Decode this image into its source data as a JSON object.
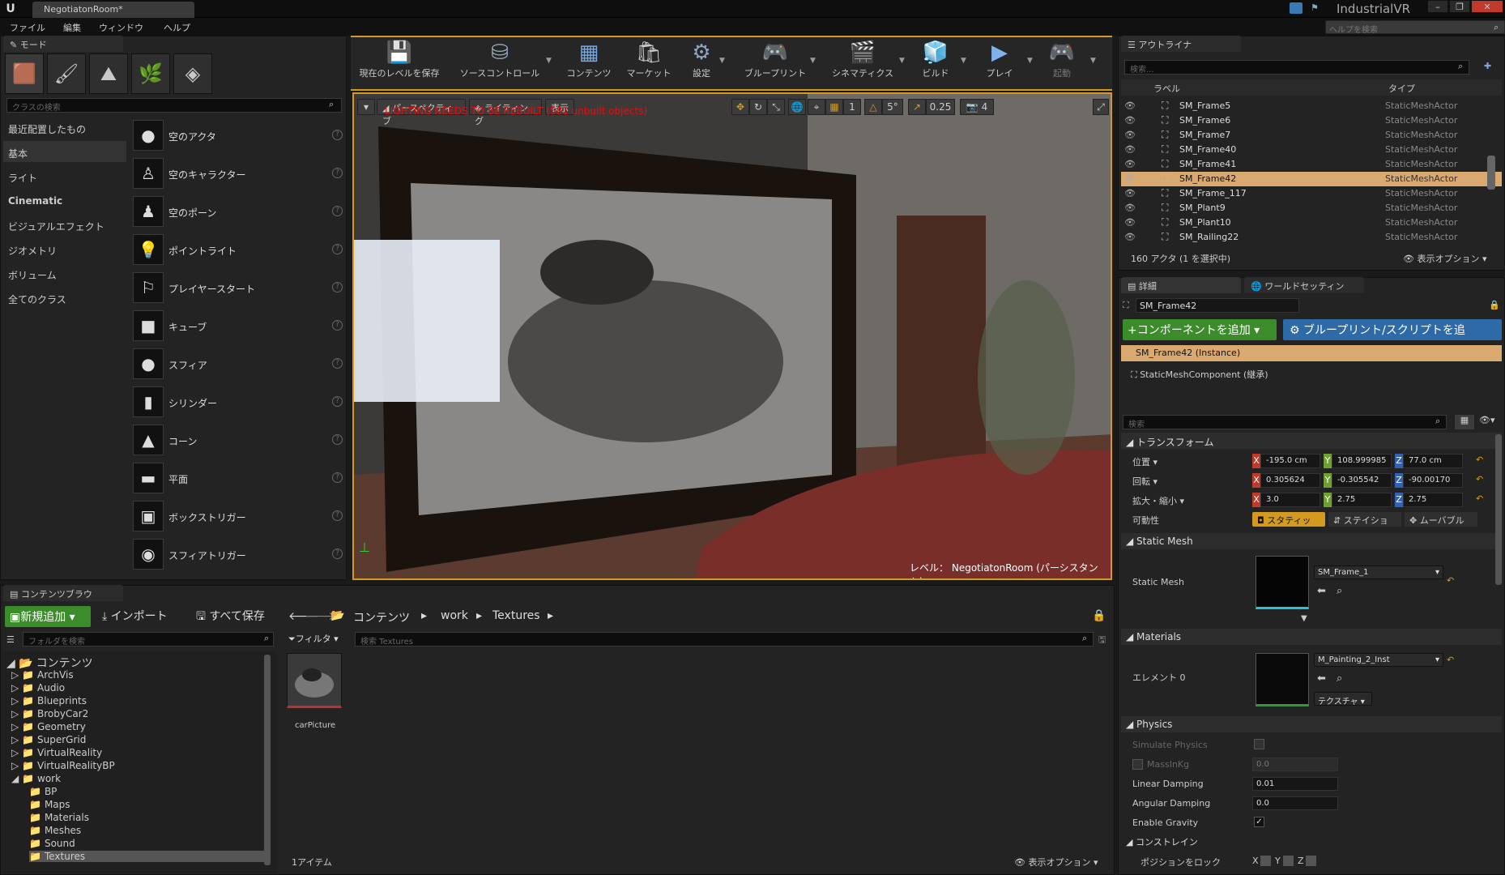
{
  "titlebar": {
    "tab": "NegotiatonRoom*",
    "project": "IndustrialVR"
  },
  "menu": [
    "ファイル",
    "編集",
    "ウィンドウ",
    "ヘルプ"
  ],
  "help_search": {
    "placeholder": "ヘルプを検索"
  },
  "modes": {
    "tab": "モード",
    "search_placeholder": "クラスの検索",
    "categories": [
      "最近配置したもの",
      "基本",
      "ライト",
      "Cinematic",
      "ビジュアルエフェクト",
      "ジオメトリ",
      "ボリューム",
      "全てのクラス"
    ],
    "selected_category": "基本",
    "items": [
      {
        "label": "空のアクタ",
        "icon": "sphere-icon"
      },
      {
        "label": "空のキャラクター",
        "icon": "character-icon"
      },
      {
        "label": "空のポーン",
        "icon": "pawn-icon"
      },
      {
        "label": "ポイントライト",
        "icon": "lightbulb-icon"
      },
      {
        "label": "プレイヤースタート",
        "icon": "flag-icon"
      },
      {
        "label": "キューブ",
        "icon": "cube-icon"
      },
      {
        "label": "スフィア",
        "icon": "sphere-icon"
      },
      {
        "label": "シリンダー",
        "icon": "cylinder-icon"
      },
      {
        "label": "コーン",
        "icon": "cone-icon"
      },
      {
        "label": "平面",
        "icon": "plane-icon"
      },
      {
        "label": "ボックストリガー",
        "icon": "box-trigger-icon"
      },
      {
        "label": "スフィアトリガー",
        "icon": "sphere-trigger-icon"
      }
    ]
  },
  "toolbar": [
    {
      "label": "現在のレベルを保存",
      "icon": "save-icon"
    },
    {
      "label": "ソースコントロール",
      "icon": "source-control-icon"
    },
    {
      "label": "コンテンツ",
      "icon": "content-icon"
    },
    {
      "label": "マーケット",
      "icon": "marketplace-icon"
    },
    {
      "label": "設定",
      "icon": "settings-icon"
    },
    {
      "label": "ブループリント",
      "icon": "blueprint-icon"
    },
    {
      "label": "シネマティクス",
      "icon": "cinematics-icon"
    },
    {
      "label": "ビルド",
      "icon": "build-icon"
    },
    {
      "label": "プレイ",
      "icon": "play-icon"
    },
    {
      "label": "起動",
      "icon": "launch-icon"
    }
  ],
  "viewport": {
    "perspective": "パースペクティブ",
    "lighting": "ライティング",
    "show": "表示",
    "warning": "LIGHTING NEEDS TO BE REBUILT (581 unbuilt objects)",
    "snap_angle": "5°",
    "scale_snap": "0.25",
    "cam_speed": "4",
    "grid_value": "1",
    "level_label": "レベル：",
    "level_name": "NegotiatonRoom (パーシスタント)"
  },
  "outliner": {
    "tab": "アウトライナ",
    "search_placeholder": "検索...",
    "col_label": "ラベル",
    "col_type": "タイプ",
    "rows": [
      {
        "label": "SM_Frame5",
        "type": "StaticMeshActor",
        "selected": false
      },
      {
        "label": "SM_Frame6",
        "type": "StaticMeshActor",
        "selected": false
      },
      {
        "label": "SM_Frame7",
        "type": "StaticMeshActor",
        "selected": false
      },
      {
        "label": "SM_Frame40",
        "type": "StaticMeshActor",
        "selected": false
      },
      {
        "label": "SM_Frame41",
        "type": "StaticMeshActor",
        "selected": false
      },
      {
        "label": "SM_Frame42",
        "type": "StaticMeshActor",
        "selected": true
      },
      {
        "label": "SM_Frame_117",
        "type": "StaticMeshActor",
        "selected": false
      },
      {
        "label": "SM_Plant9",
        "type": "StaticMeshActor",
        "selected": false
      },
      {
        "label": "SM_Plant10",
        "type": "StaticMeshActor",
        "selected": false
      },
      {
        "label": "SM_Railing22",
        "type": "StaticMeshActor",
        "selected": false
      }
    ],
    "status": "160 アクタ (1 を選択中)",
    "view_options": "表示オプション"
  },
  "details": {
    "tab": "詳細",
    "tab2": "ワールドセッティン",
    "name": "SM_Frame42",
    "add_component": "コンポーネントを追加",
    "blueprint_script": "ブループリント/スクリプトを追",
    "instance": "SM_Frame42 (Instance)",
    "component": "StaticMeshComponent (継承)",
    "search_placeholder": "検索",
    "transform": {
      "header": "トランスフォーム",
      "location_label": "位置",
      "rotation_label": "回転",
      "scale_label": "拡大・縮小",
      "mobility_label": "可動性",
      "location": [
        "-195.0 cm",
        "108.999985",
        "77.0 cm"
      ],
      "rotation": [
        "0.305624",
        "-0.305542",
        "-90.00170"
      ],
      "scale": [
        "3.0",
        "2.75",
        "2.75"
      ],
      "mobility": [
        "スタティッ",
        "ステイショ",
        "ムーバブル"
      ]
    },
    "static_mesh": {
      "header": "Static Mesh",
      "label": "Static Mesh",
      "value": "SM_Frame_1"
    },
    "materials": {
      "header": "Materials",
      "label": "エレメント 0",
      "value": "M_Painting_2_Inst",
      "texture_btn": "テクスチャ"
    },
    "physics": {
      "header": "Physics",
      "simulate": "Simulate Physics",
      "mass": "MassInKg",
      "mass_value": "0.0",
      "linear": "Linear Damping",
      "linear_value": "0.01",
      "angular": "Angular Damping",
      "angular_value": "0.0",
      "gravity": "Enable Gravity"
    },
    "constraints": {
      "header": "コンストレイン",
      "lock_position": "ポジションをロック",
      "x": "X",
      "y": "Y",
      "z": "Z"
    }
  },
  "content_browser": {
    "tab": "コンテンツブラウ",
    "add_new": "新規追加",
    "import": "インポート",
    "save_all": "すべて保存",
    "breadcrumb": [
      "コンテンツ",
      "work",
      "Textures"
    ],
    "folder_search": "フォルダを検索",
    "filter": "フィルタ",
    "asset_search": "検索 Textures",
    "root": "コンテンツ",
    "folders": [
      "ArchVis",
      "Audio",
      "Blueprints",
      "BrobyCar2",
      "Geometry",
      "SuperGrid",
      "VirtualReality",
      "VirtualRealityBP",
      "work"
    ],
    "subfolders": [
      "BP",
      "Maps",
      "Materials",
      "Meshes",
      "Sound",
      "Textures"
    ],
    "asset": "carPicture",
    "item_count": "1アイテム",
    "view_options": "表示オプション"
  }
}
